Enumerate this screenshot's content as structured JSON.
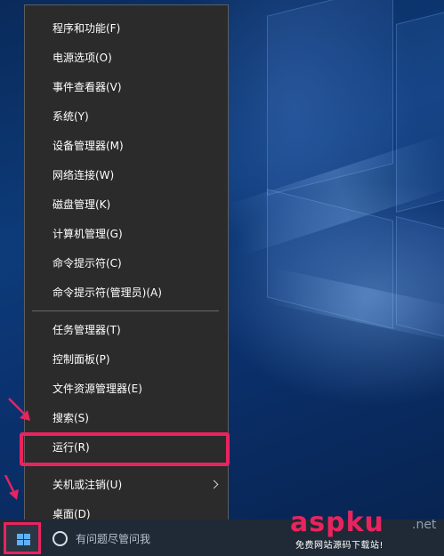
{
  "colors": {
    "menu_background": "#2b2b2b",
    "menu_text": "#ffffff",
    "annotation": "#e8245f",
    "taskbar": "#1f2a36",
    "windows_logo": "#5fb0f5"
  },
  "context_menu": {
    "items": [
      {
        "label": "程序和功能(F)"
      },
      {
        "label": "电源选项(O)"
      },
      {
        "label": "事件查看器(V)"
      },
      {
        "label": "系统(Y)"
      },
      {
        "label": "设备管理器(M)"
      },
      {
        "label": "网络连接(W)"
      },
      {
        "label": "磁盘管理(K)"
      },
      {
        "label": "计算机管理(G)"
      },
      {
        "label": "命令提示符(C)"
      },
      {
        "label": "命令提示符(管理员)(A)"
      },
      {
        "label": "任务管理器(T)"
      },
      {
        "label": "控制面板(P)"
      },
      {
        "label": "文件资源管理器(E)"
      },
      {
        "label": "搜索(S)"
      },
      {
        "label": "运行(R)",
        "highlighted": true
      },
      {
        "label": "关机或注销(U)",
        "has_submenu": true,
        "icon": "chevron-right-icon"
      },
      {
        "label": "桌面(D)"
      }
    ]
  },
  "taskbar": {
    "start_icon": "windows-logo-icon",
    "search_icon": "cortana-circle-icon",
    "search_placeholder": "有问题尽管问我"
  },
  "watermark": {
    "logo_text": "aspku",
    "suffix": ".net",
    "tagline": "免费网站源码下载站!"
  }
}
